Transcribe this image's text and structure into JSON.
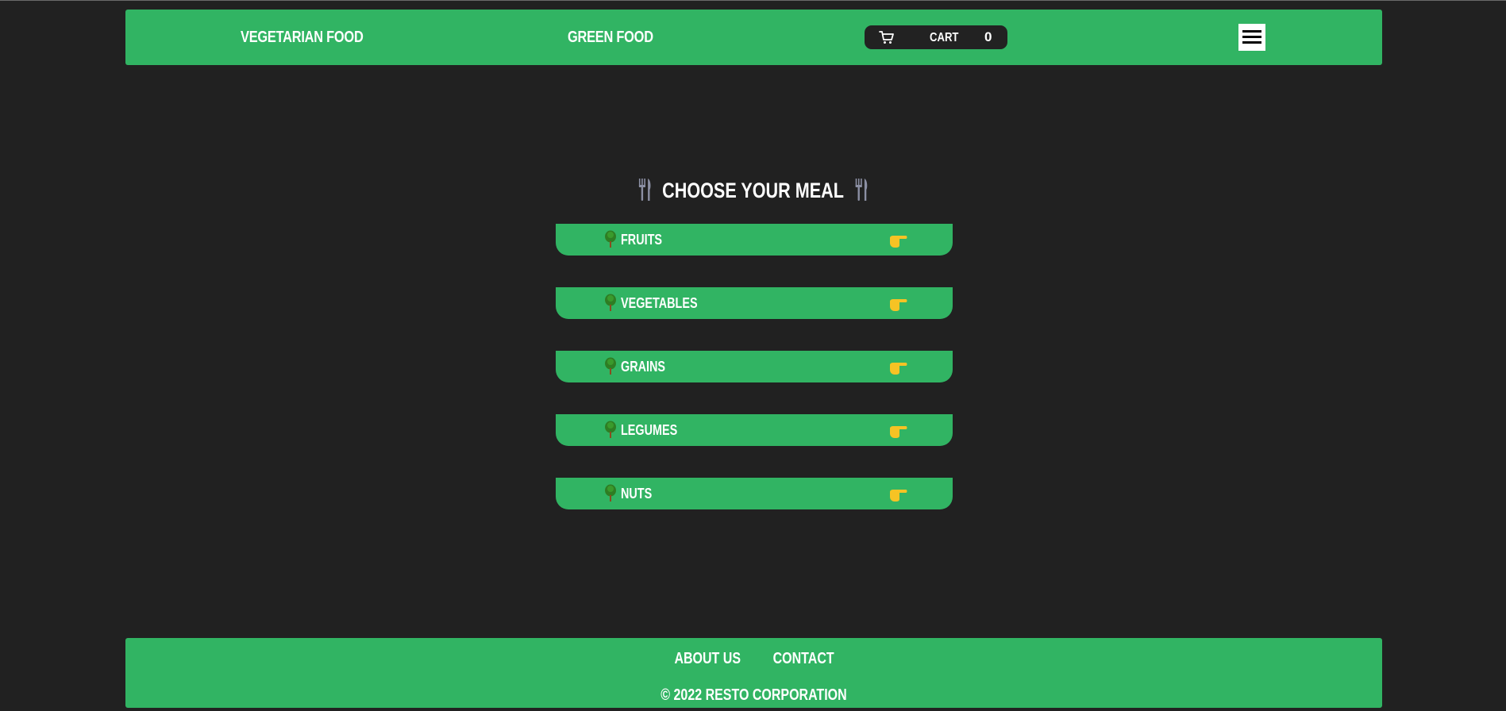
{
  "colors": {
    "background": "#212121",
    "accent_green": "#31b463",
    "cart_bg": "#222222",
    "text": "#ffffff"
  },
  "header": {
    "brand_left": "VEGETARIAN FOOD",
    "brand_right": "GREEN FOOD",
    "cart": {
      "icon": "cart-icon",
      "label": "CART",
      "count": "0"
    },
    "menu_icon": "hamburger-menu-icon"
  },
  "main": {
    "title": "CHOOSE YOUR MEAL",
    "title_icon": "fork-and-knife-icon",
    "items": [
      {
        "label": "FRUITS",
        "icon": "tree-icon",
        "action_icon": "pointing-right-icon"
      },
      {
        "label": "VEGETABLES",
        "icon": "tree-icon",
        "action_icon": "pointing-right-icon"
      },
      {
        "label": "GRAINS",
        "icon": "tree-icon",
        "action_icon": "pointing-right-icon"
      },
      {
        "label": "LEGUMES",
        "icon": "tree-icon",
        "action_icon": "pointing-right-icon"
      },
      {
        "label": "NUTS",
        "icon": "tree-icon",
        "action_icon": "pointing-right-icon"
      }
    ]
  },
  "footer": {
    "links": [
      "ABOUT US",
      "CONTACT"
    ],
    "copyright": "© 2022 RESTO CORPORATION"
  }
}
